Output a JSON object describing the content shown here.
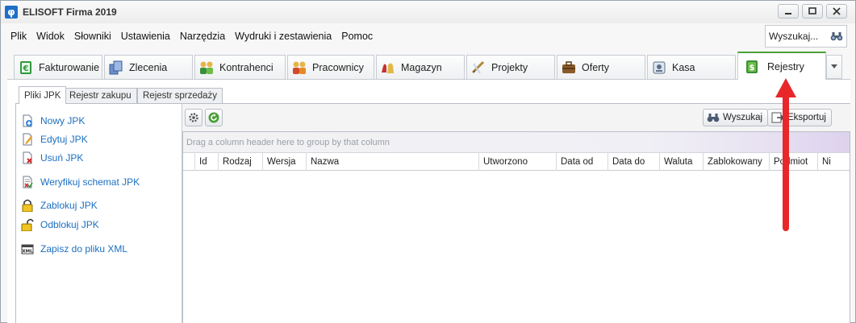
{
  "window": {
    "title": "ELISOFT Firma 2019",
    "app_icon_glyph": "φ",
    "buttons": {
      "minimize": "▁",
      "maximize": "▢",
      "close": "✕"
    }
  },
  "menu": {
    "items": [
      "Plik",
      "Widok",
      "Słowniki",
      "Ustawienia",
      "Narzędzia",
      "Wydruki i zestawienia",
      "Pomoc"
    ],
    "search_label": "Wyszukaj..."
  },
  "module_tabs": [
    {
      "label": "Fakturowanie",
      "icon": "invoice-icon"
    },
    {
      "label": "Zlecenia",
      "icon": "orders-icon"
    },
    {
      "label": "Kontrahenci",
      "icon": "contractors-icon"
    },
    {
      "label": "Pracownicy",
      "icon": "employees-icon"
    },
    {
      "label": "Magazyn",
      "icon": "warehouse-icon"
    },
    {
      "label": "Projekty",
      "icon": "projects-icon"
    },
    {
      "label": "Oferty",
      "icon": "offers-icon"
    },
    {
      "label": "Kasa",
      "icon": "cashbox-icon"
    },
    {
      "label": "Rejestry",
      "icon": "registers-icon",
      "active": true
    }
  ],
  "sub_tabs": [
    "Pliki JPK",
    "Rejestr zakupu",
    "Rejestr sprzedaży"
  ],
  "actions": [
    {
      "label": "Nowy JPK",
      "icon": "new-document-icon"
    },
    {
      "label": "Edytuj JPK",
      "icon": "edit-document-icon"
    },
    {
      "label": "Usuń JPK",
      "icon": "delete-document-icon"
    },
    {
      "label": "Weryfikuj schemat JPK",
      "icon": "verify-schema-icon"
    },
    {
      "label": "Zablokuj JPK",
      "icon": "lock-icon"
    },
    {
      "label": "Odblokuj JPK",
      "icon": "unlock-icon"
    },
    {
      "label": "Zapisz do pliku XML",
      "icon": "xml-file-icon"
    }
  ],
  "grid": {
    "toolbar": {
      "search_button": "Wyszukaj",
      "export_button": "Eksportuj"
    },
    "group_panel_hint": "Drag a column header here to group by that column",
    "columns": [
      "Id",
      "Rodzaj",
      "Wersja",
      "Nazwa",
      "Utworzono",
      "Data od",
      "Data do",
      "Waluta",
      "Zablokowany",
      "Podmiot",
      "Ni"
    ]
  },
  "colors": {
    "accent_green": "#4aa03a",
    "link_blue": "#1c6fc2",
    "annotation_red": "#e8272b"
  }
}
